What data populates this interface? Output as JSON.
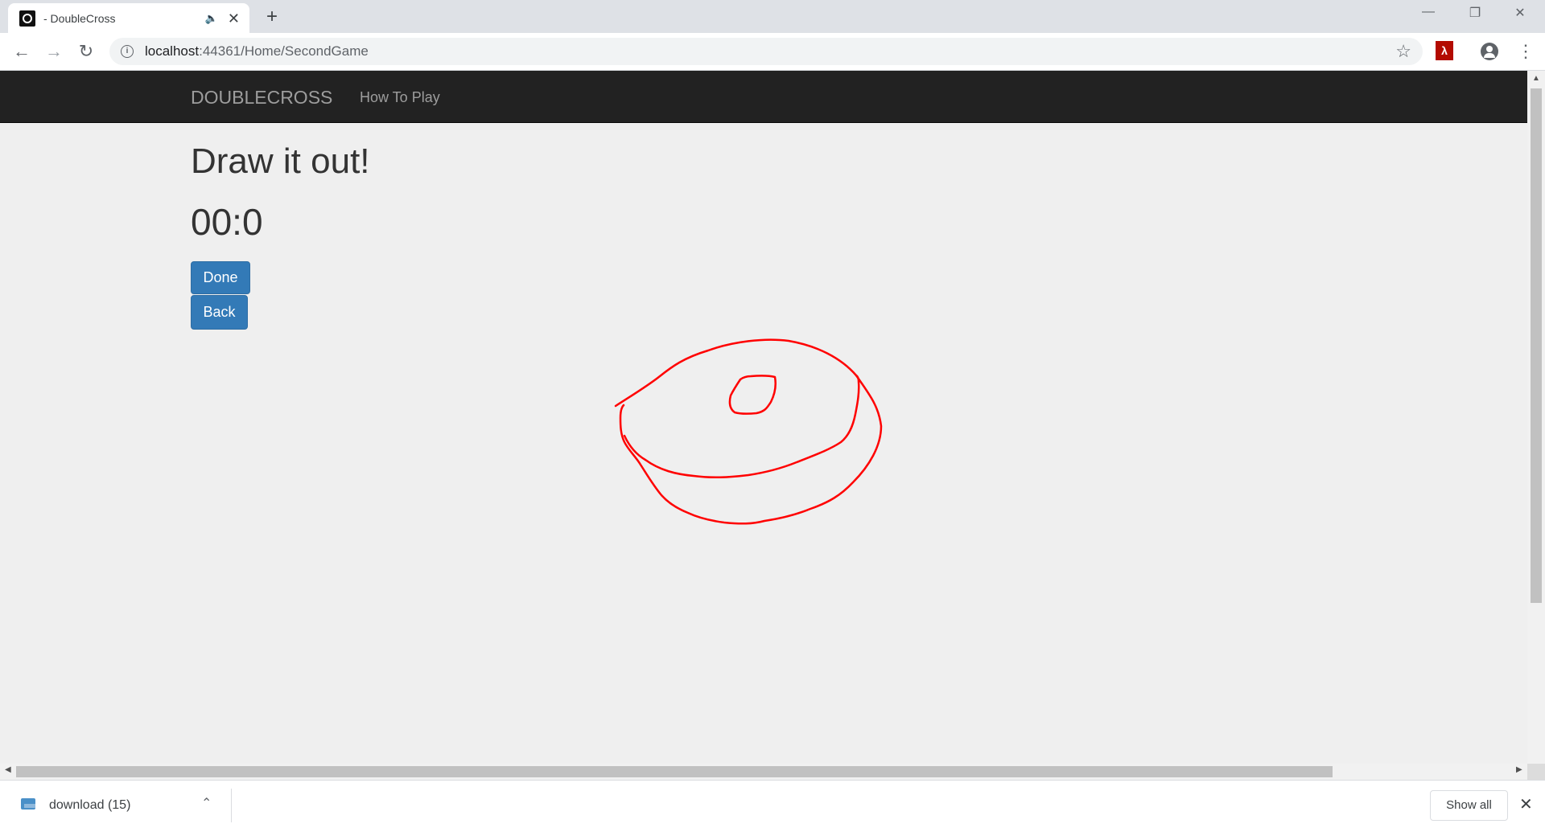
{
  "browser": {
    "tab_title": "- DoubleCross",
    "audio_icon": "speaker-icon",
    "new_tab": "+",
    "url_host": "localhost",
    "url_rest": ":44361/Home/SecondGame"
  },
  "navbar": {
    "brand": "DOUBLECROSS",
    "link": "How To Play",
    "background": "#222222"
  },
  "main": {
    "title": "Draw it out!",
    "timer": "00:0",
    "done_label": "Done",
    "back_label": "Back",
    "button_color": "#337ab7"
  },
  "drawing": {
    "stroke_color": "#ff0000"
  },
  "downloads": {
    "file_name": "download (15)",
    "show_all": "Show all"
  }
}
